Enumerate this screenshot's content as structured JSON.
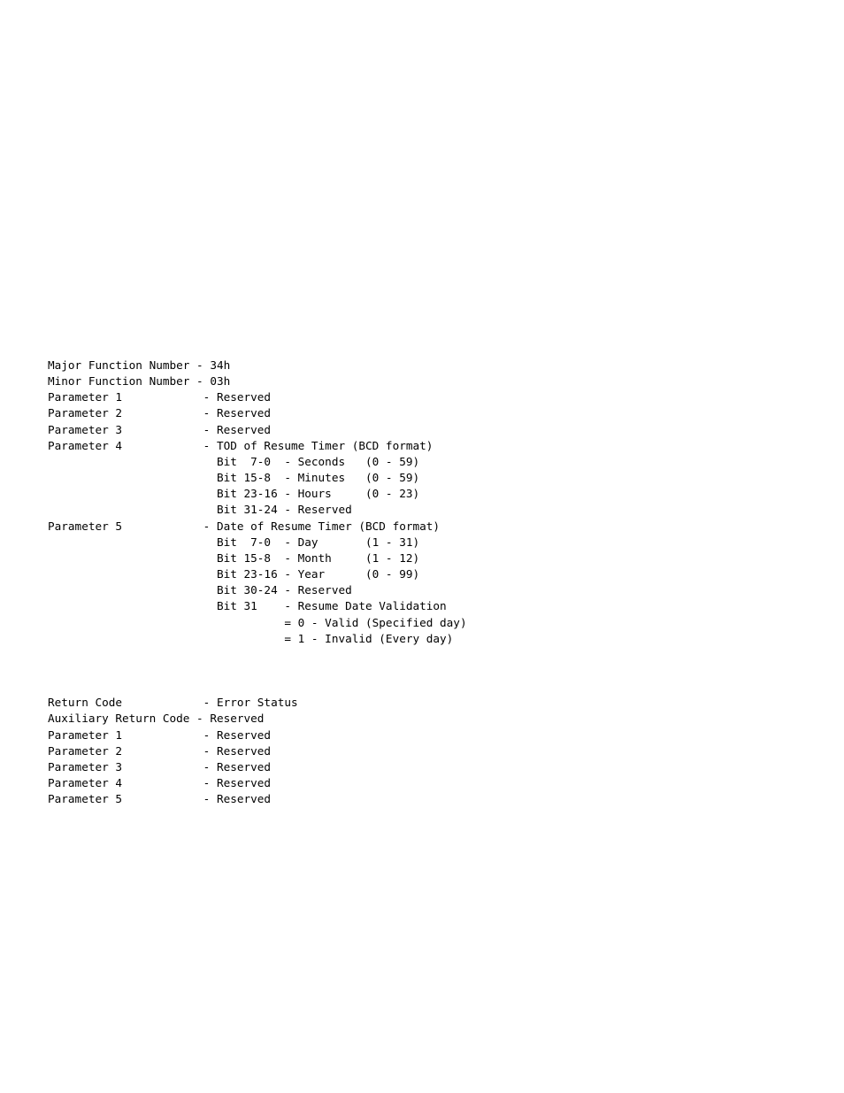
{
  "document": {
    "page_background": "#ffffff",
    "text_color": "#000000",
    "input_block": {
      "lines": [
        "Major Function Number - 34h",
        "Minor Function Number - 03h",
        "Parameter 1            - Reserved",
        "Parameter 2            - Reserved",
        "Parameter 3            - Reserved",
        "Parameter 4            - TOD of Resume Timer (BCD format)",
        "                         Bit  7-0  - Seconds   (0 - 59)",
        "                         Bit 15-8  - Minutes   (0 - 59)",
        "                         Bit 23-16 - Hours     (0 - 23)",
        "                         Bit 31-24 - Reserved",
        "Parameter 5            - Date of Resume Timer (BCD format)",
        "                         Bit  7-0  - Day       (1 - 31)",
        "                         Bit 15-8  - Month     (1 - 12)",
        "                         Bit 23-16 - Year      (0 - 99)",
        "                         Bit 30-24 - Reserved",
        "                         Bit 31    - Resume Date Validation",
        "                                   = 0 - Valid (Specified day)",
        "                                   = 1 - Invalid (Every day)"
      ]
    },
    "output_block": {
      "lines": [
        "Return Code            - Error Status",
        "Auxiliary Return Code - Reserved",
        "Parameter 1            - Reserved",
        "Parameter 2            - Reserved",
        "Parameter 3            - Reserved",
        "Parameter 4            - Reserved",
        "Parameter 5            - Reserved"
      ]
    },
    "fields": {
      "major_function_number": "34h",
      "minor_function_number": "03h",
      "parameter_4_description": "TOD of Resume Timer (BCD format)",
      "parameter_5_description": "Date of Resume Timer (BCD format)",
      "return_code_description": "Error Status",
      "reserved_label": "Reserved",
      "tod_bitfields": [
        {
          "bits": "Bit  7-0",
          "name": "Seconds",
          "range": "(0 - 59)"
        },
        {
          "bits": "Bit 15-8",
          "name": "Minutes",
          "range": "(0 - 59)"
        },
        {
          "bits": "Bit 23-16",
          "name": "Hours",
          "range": "(0 - 23)"
        },
        {
          "bits": "Bit 31-24",
          "name": "Reserved",
          "range": ""
        }
      ],
      "date_bitfields": [
        {
          "bits": "Bit  7-0",
          "name": "Day",
          "range": "(1 - 31)"
        },
        {
          "bits": "Bit 15-8",
          "name": "Month",
          "range": "(1 - 12)"
        },
        {
          "bits": "Bit 23-16",
          "name": "Year",
          "range": "(0 - 99)"
        },
        {
          "bits": "Bit 30-24",
          "name": "Reserved",
          "range": ""
        },
        {
          "bits": "Bit 31",
          "name": "Resume Date Validation",
          "range": ""
        }
      ],
      "validation_values": [
        "= 0 - Valid (Specified day)",
        "= 1 - Invalid (Every day)"
      ]
    }
  }
}
